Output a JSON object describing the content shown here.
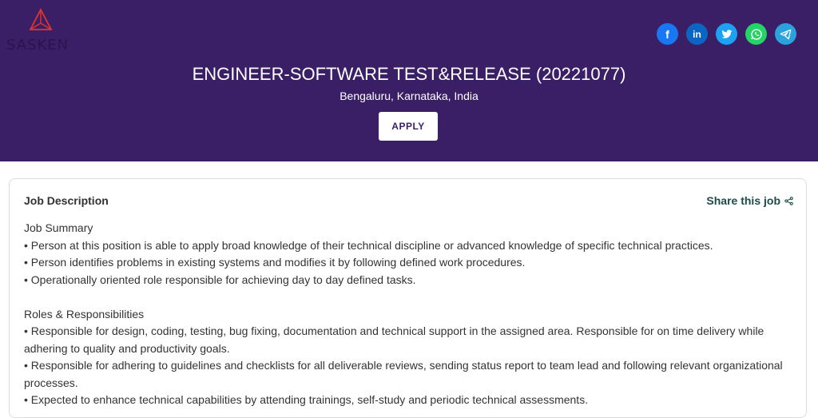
{
  "logo": {
    "text": "SASKEN"
  },
  "social": [
    {
      "name": "facebook",
      "glyph": "f",
      "color": "#1877f2"
    },
    {
      "name": "linkedin",
      "glyph": "in",
      "color": "#0a66c2"
    },
    {
      "name": "twitter",
      "glyph": "t",
      "color": "#1da1f2"
    },
    {
      "name": "whatsapp",
      "glyph": "w",
      "color": "#25d366"
    },
    {
      "name": "telegram",
      "glyph": "➤",
      "color": "#2aa3dd"
    }
  ],
  "job": {
    "title": "ENGINEER-SOFTWARE TEST&RELEASE (20221077)",
    "location": "Bengaluru, Karnataka, India",
    "apply_label": "APPLY"
  },
  "card": {
    "title": "Job Description",
    "share_label": "Share this job",
    "summary_heading": "Job Summary",
    "summary_items": [
      "• Person at this position is able to apply broad knowledge of their technical discipline or advanced knowledge of specific technical practices.",
      "• Person identifies problems in existing systems and modifies it by following defined work procedures.",
      "• Operationally oriented role responsible for achieving day to day defined tasks."
    ],
    "roles_heading": "Roles & Responsibilities",
    "roles_items": [
      "• Responsible for design, coding, testing, bug fixing, documentation and technical support in the assigned area. Responsible for on time delivery while adhering to quality and productivity goals.",
      "• Responsible for adhering to guidelines and checklists for all deliverable reviews, sending status report to team lead and following relevant organizational processes.",
      "• Expected to enhance technical capabilities by attending trainings, self-study and periodic technical assessments."
    ]
  },
  "colors": {
    "hero_bg": "#3a1f67",
    "logo_red": "#e0352b"
  }
}
